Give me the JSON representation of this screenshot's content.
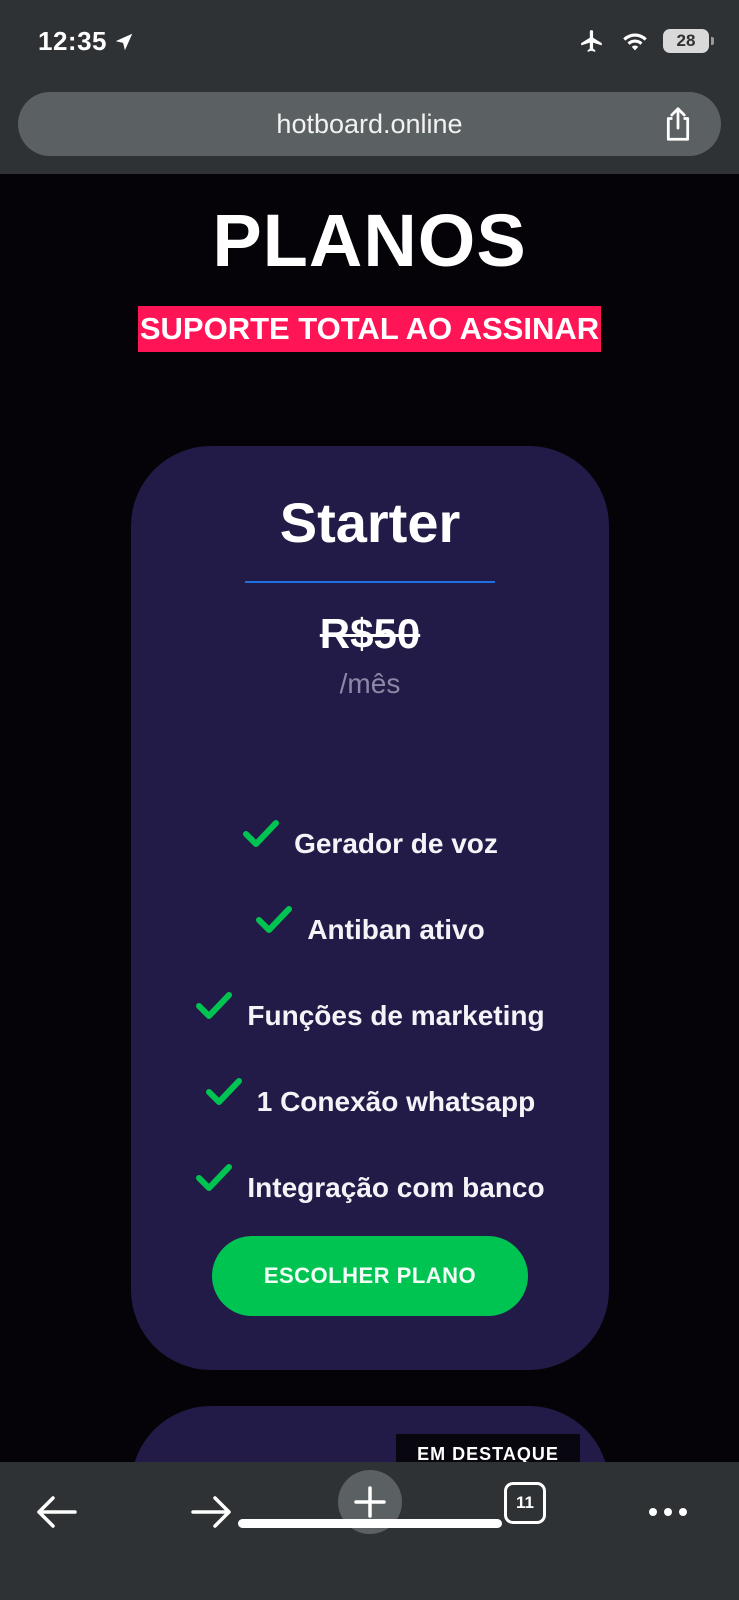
{
  "status_bar": {
    "time": "12:35",
    "battery": "28"
  },
  "browser": {
    "url": "hotboard.online",
    "tab_count": "11"
  },
  "page": {
    "headline": "PLANOS",
    "subheadline": "SUPORTE TOTAL AO ASSINAR",
    "plan": {
      "name": "Starter",
      "price_old": "R$50",
      "period": "/mês",
      "features": [
        "Gerador de voz",
        "Antiban ativo",
        "Funções de marketing",
        "1 Conexão whatsapp",
        "Integração com banco"
      ],
      "cta_label": "ESCOLHER PLANO"
    },
    "next_plan_badge": "EM DESTAQUE"
  },
  "colors": {
    "background": "#050208",
    "card": "#231b47",
    "accent_red": "#ff1556",
    "accent_green": "#00c452",
    "divider_blue": "#1f6fe0",
    "chrome": "#2f3234"
  },
  "icons": {
    "location": "location-arrow-icon",
    "airplane": "airplane-icon",
    "wifi": "wifi-icon",
    "share": "share-icon",
    "check": "check-icon",
    "back": "arrow-left-icon",
    "forward": "arrow-right-icon",
    "new_tab": "plus-icon",
    "tabs": "tabs-icon",
    "more": "more-icon"
  }
}
